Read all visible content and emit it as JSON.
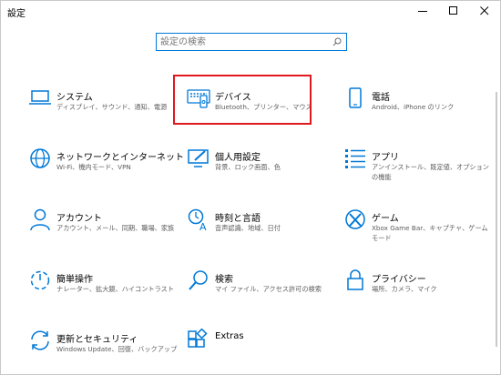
{
  "window": {
    "title": "設定"
  },
  "search": {
    "placeholder": "設定の検索"
  },
  "accent": "#0078d7",
  "highlight_color": "#e0181f",
  "tiles": [
    {
      "icon": "laptop-icon",
      "label": "システム",
      "desc": "ディスプレイ、サウンド、通知、電源"
    },
    {
      "icon": "keyboard-icon",
      "label": "デバイス",
      "desc": "Bluetooth、プリンター、マウス"
    },
    {
      "icon": "phone-icon",
      "label": "電話",
      "desc": "Android、iPhone のリンク"
    },
    {
      "icon": "globe-icon",
      "label": "ネットワークとインターネット",
      "desc": "Wi-Fi、機内モード、VPN"
    },
    {
      "icon": "personalization-icon",
      "label": "個人用設定",
      "desc": "背景、ロック画面、色"
    },
    {
      "icon": "apps-icon",
      "label": "アプリ",
      "desc": "アンインストール、既定値、オプションの機能"
    },
    {
      "icon": "person-icon",
      "label": "アカウント",
      "desc": "アカウント、メール、同期、職場、家族"
    },
    {
      "icon": "time-language-icon",
      "label": "時刻と言語",
      "desc": "音声認識、地域、日付"
    },
    {
      "icon": "xbox-icon",
      "label": "ゲーム",
      "desc": "Xbox Game Bar、キャプチャ、ゲーム モード"
    },
    {
      "icon": "ease-of-access-icon",
      "label": "簡単操作",
      "desc": "ナレーター、拡大鏡、ハイコントラスト"
    },
    {
      "icon": "search-icon",
      "label": "検索",
      "desc": "マイ ファイル、アクセス許可の検索"
    },
    {
      "icon": "lock-icon",
      "label": "プライバシー",
      "desc": "場所、カメラ、マイク"
    },
    {
      "icon": "update-icon",
      "label": "更新とセキュリティ",
      "desc": "Windows Update、回復、バックアップ"
    },
    {
      "icon": "extras-icon",
      "label": "Extras",
      "desc": ""
    }
  ]
}
